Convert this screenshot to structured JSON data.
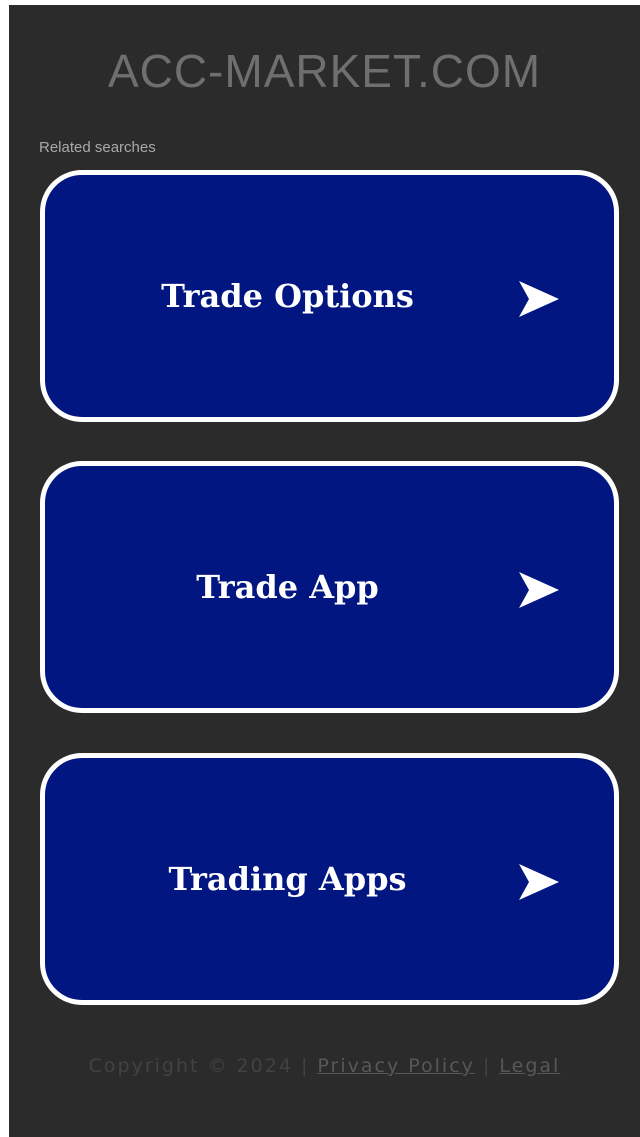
{
  "site": {
    "title": "ACC-MARKET.COM"
  },
  "related": {
    "label": "Related searches",
    "items": [
      {
        "label": "Trade Options",
        "icon": "arrow-right-icon"
      },
      {
        "label": "Trade App",
        "icon": "arrow-right-icon"
      },
      {
        "label": "Trading Apps",
        "icon": "arrow-right-icon"
      }
    ]
  },
  "footer": {
    "copyright": "Copyright © 2024",
    "separator": "|",
    "privacy_label": "Privacy Policy",
    "legal_label": "Legal"
  },
  "colors": {
    "background": "#2b2b2b",
    "card_fill": "#021681",
    "card_border": "#ffffff",
    "title_text": "#6f6f6f"
  }
}
